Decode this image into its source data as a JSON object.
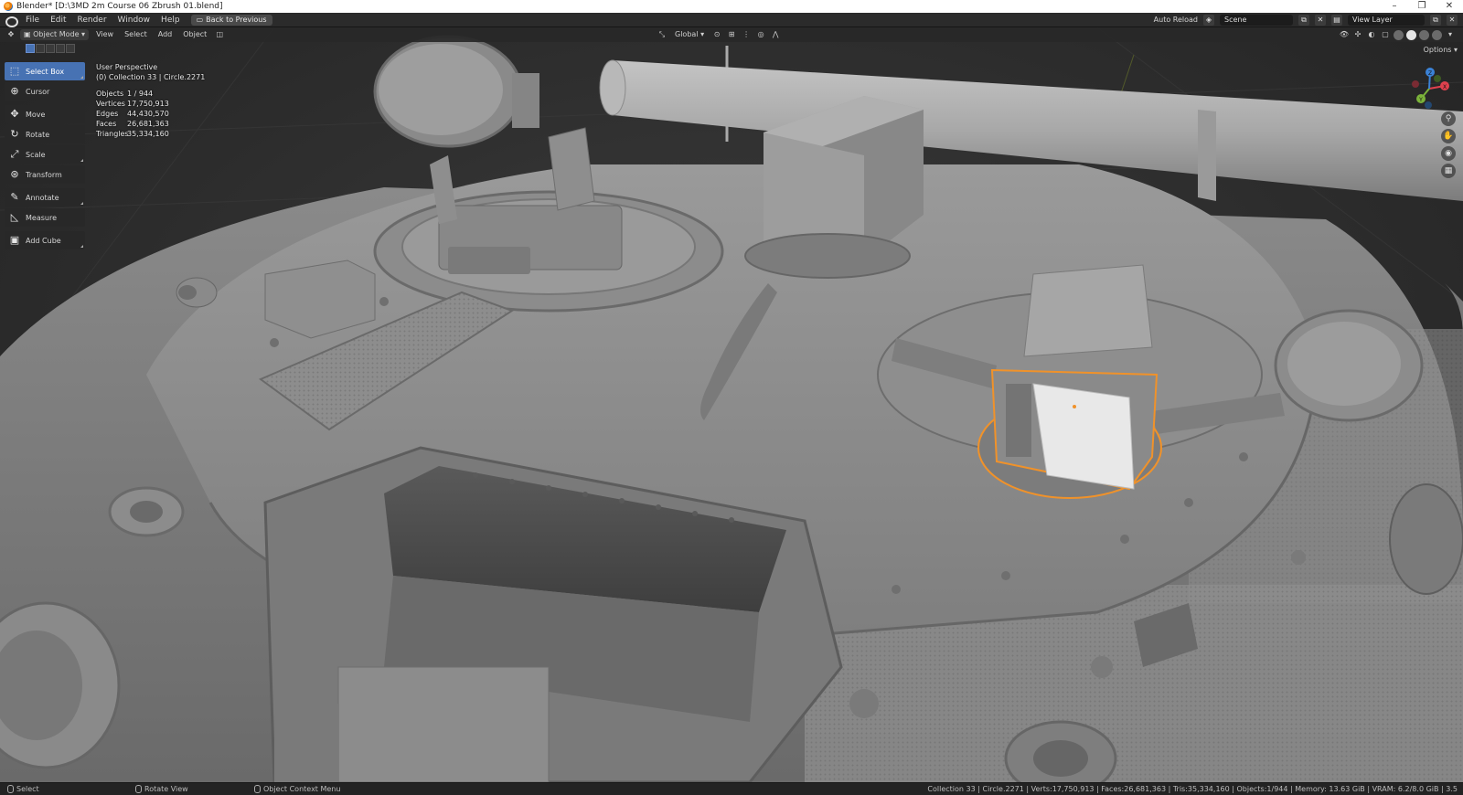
{
  "window": {
    "title": "Blender* [D:\\3MD 2m Course 06 Zbrush 01.blend]",
    "minimize": "–",
    "maximize": "❐",
    "close": "✕"
  },
  "topbar": {
    "menus": [
      "File",
      "Edit",
      "Render",
      "Window",
      "Help"
    ],
    "back_to_previous": "Back to Previous",
    "auto_reload": "Auto Reload",
    "scene": "Scene",
    "view_layer": "View Layer"
  },
  "viewport_header": {
    "mode": "Object Mode",
    "menus": [
      "View",
      "Select",
      "Add",
      "Object"
    ],
    "transform_orientation": "Global"
  },
  "toolbar": {
    "tools": [
      {
        "label": "Select Box",
        "icon": "select-box-icon",
        "glyph": "⬚"
      },
      {
        "label": "Cursor",
        "icon": "cursor-icon",
        "glyph": "⊕"
      },
      {
        "label": "Move",
        "icon": "move-icon",
        "glyph": "✥"
      },
      {
        "label": "Rotate",
        "icon": "rotate-icon",
        "glyph": "↻"
      },
      {
        "label": "Scale",
        "icon": "scale-icon",
        "glyph": "⤢"
      },
      {
        "label": "Transform",
        "icon": "transform-icon",
        "glyph": "⊛"
      },
      {
        "label": "Annotate",
        "icon": "annotate-icon",
        "glyph": "✎"
      },
      {
        "label": "Measure",
        "icon": "measure-icon",
        "glyph": "📐"
      },
      {
        "label": "Add Cube",
        "icon": "add-cube-icon",
        "glyph": "▣"
      }
    ]
  },
  "overlay": {
    "perspective": "User Perspective",
    "collection": "(0) Collection 33 | Circle.2271",
    "stats": [
      {
        "key": "Objects",
        "value": "1 / 944"
      },
      {
        "key": "Vertices",
        "value": "17,750,913"
      },
      {
        "key": "Edges",
        "value": "44,430,570"
      },
      {
        "key": "Faces",
        "value": "26,681,363"
      },
      {
        "key": "Triangles",
        "value": "35,334,160"
      }
    ]
  },
  "options": "Options",
  "gizmo": {
    "x": "X",
    "y": "Y",
    "z": "Z"
  },
  "statusbar": {
    "select": "Select",
    "rotate_view": "Rotate View",
    "context_menu": "Object Context Menu",
    "stats": "Collection 33 | Circle.2271 | Verts:17,750,913 | Faces:26,681,363 | Tris:35,334,160 | Objects:1/944 | Memory: 13.63 GiB | VRAM: 6.2/8.0 GiB | 3.5"
  },
  "colors": {
    "selection_outline": "#f0922a",
    "active_tool": "#4772b3",
    "background": "#2a2a2a"
  }
}
